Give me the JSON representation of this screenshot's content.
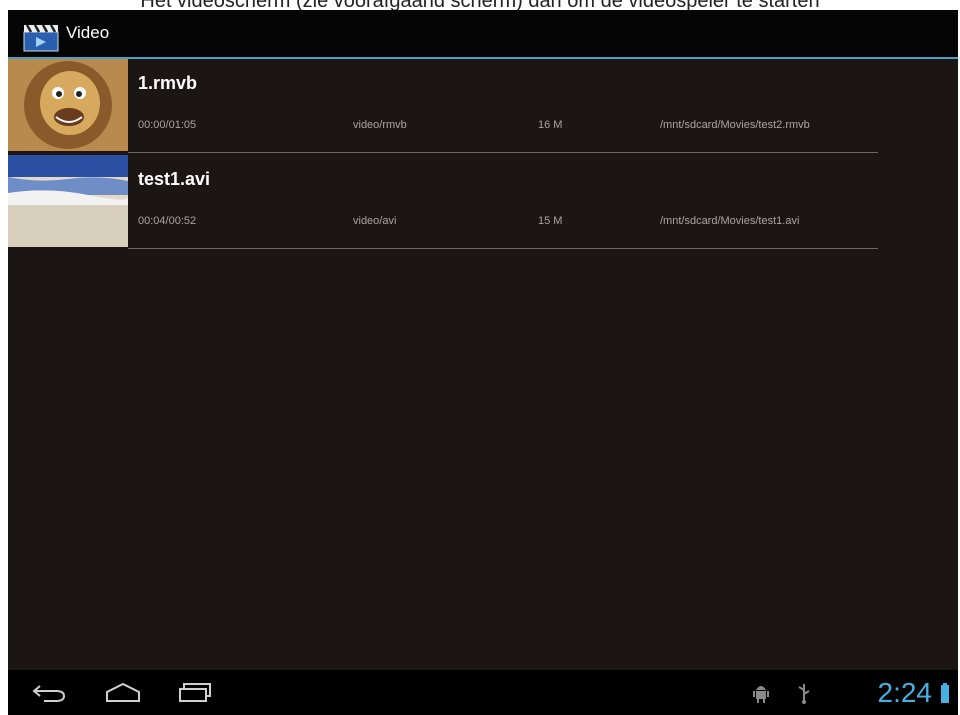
{
  "caption": "Het videoscherm (zie voorafgaand scherm) dan om de videospeler te starten",
  "app": {
    "title": "Video",
    "icon": "video-clapper-icon"
  },
  "videos": [
    {
      "name": "1.rmvb",
      "duration": "00:00/01:05",
      "mime": "video/rmvb",
      "size": "16 M",
      "path": "/mnt/sdcard/Movies/test2.rmvb",
      "thumb": "lion-thumbnail"
    },
    {
      "name": "test1.avi",
      "duration": "00:04/00:52",
      "mime": "video/avi",
      "size": "15 M",
      "path": "/mnt/sdcard/Movies/test1.avi",
      "thumb": "beach-thumbnail"
    }
  ],
  "navbar": {
    "buttons": [
      "back-icon",
      "home-icon",
      "recent-apps-icon"
    ],
    "clock": "2:24",
    "status_icons": [
      "android-debug-icon",
      "usb-icon",
      "battery-icon"
    ]
  },
  "colors": {
    "accent": "#4aa3c7",
    "clock": "#46b0e0",
    "background": "#1b1613"
  }
}
